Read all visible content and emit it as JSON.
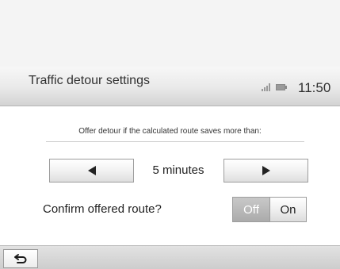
{
  "header": {
    "title": "Traffic detour settings",
    "clock": "11:50",
    "signal_icon": "signal-strength-icon",
    "battery_icon": "battery-icon"
  },
  "settings": {
    "instruction": "Offer detour if the calculated route saves more than:",
    "decrease_icon": "triangle-left-icon",
    "increase_icon": "triangle-right-icon",
    "detour_value": "5 minutes",
    "confirm_label": "Confirm offered route?",
    "toggle": {
      "off_label": "Off",
      "on_label": "On",
      "selected": "Off"
    }
  },
  "footer": {
    "back_icon": "back-arrow-icon"
  }
}
